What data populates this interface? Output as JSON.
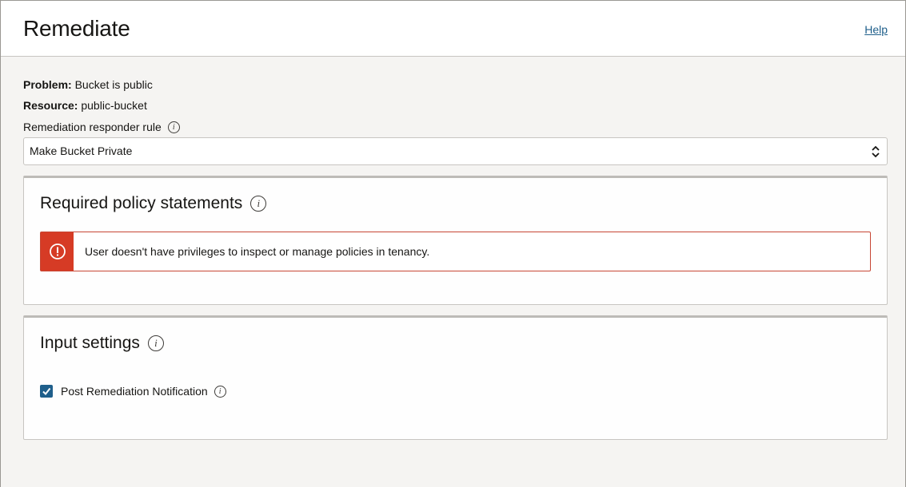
{
  "header": {
    "title": "Remediate",
    "help_link": "Help"
  },
  "details": {
    "problem_label": "Problem:",
    "problem_value": "Bucket is public",
    "resource_label": "Resource:",
    "resource_value": "public-bucket"
  },
  "responder": {
    "label": "Remediation responder rule",
    "selected": "Make Bucket Private"
  },
  "policy_panel": {
    "title": "Required policy statements",
    "alert": {
      "type": "error",
      "message": "User doesn't have privileges to inspect or manage policies in tenancy."
    }
  },
  "input_panel": {
    "title": "Input settings",
    "checkbox": {
      "label": "Post Remediation Notification",
      "checked": true
    }
  },
  "colors": {
    "error": "#d63b25",
    "link": "#1f5f8b",
    "checkbox": "#1f5f8b"
  }
}
